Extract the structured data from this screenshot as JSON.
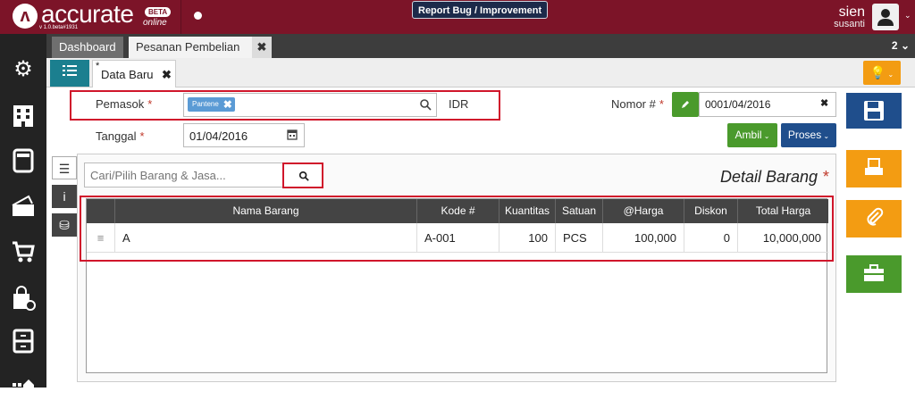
{
  "app": {
    "brand": "accurate",
    "beta": "BETA",
    "online": "online",
    "version": "v 1.0.beta#1931",
    "report_bug": "Report Bug / Improvement",
    "user_name": "sien",
    "user_sub": "susanti"
  },
  "tabs": {
    "dashboard": "Dashboard",
    "pesanan": "Pesanan Pembelian",
    "close": "✖",
    "count": "2"
  },
  "doc_tab": {
    "star": "*",
    "label": "Data Baru",
    "close": "✖"
  },
  "form": {
    "pemasok_label": "Pemasok",
    "pemasok_chip": "Pantene",
    "currency": "IDR",
    "tanggal_label": "Tanggal",
    "tanggal_value": "01/04/2016",
    "nomor_label": "Nomor #",
    "nomor_value": "0001/04/2016",
    "required": "*"
  },
  "buttons": {
    "ambil": "Ambil",
    "proses": "Proses"
  },
  "search": {
    "placeholder": "Cari/Pilih Barang & Jasa..."
  },
  "detail_title": "Detail Barang",
  "table": {
    "headers": [
      "",
      "Nama Barang",
      "Kode #",
      "Kuantitas",
      "Satuan",
      "@Harga",
      "Diskon",
      "Total Harga"
    ],
    "rows": [
      {
        "handle": "≡",
        "nama": "A",
        "kode": "A-001",
        "qty": "100",
        "satuan": "PCS",
        "harga": "100,000",
        "diskon": "0",
        "total": "10,000,000"
      }
    ]
  },
  "colors": {
    "topbar": "#7c1428",
    "accent_teal": "#1b7f8f",
    "green": "#4a9a2c",
    "blue": "#1f4e8c",
    "orange": "#f39c12",
    "highlight": "#d0162b"
  }
}
